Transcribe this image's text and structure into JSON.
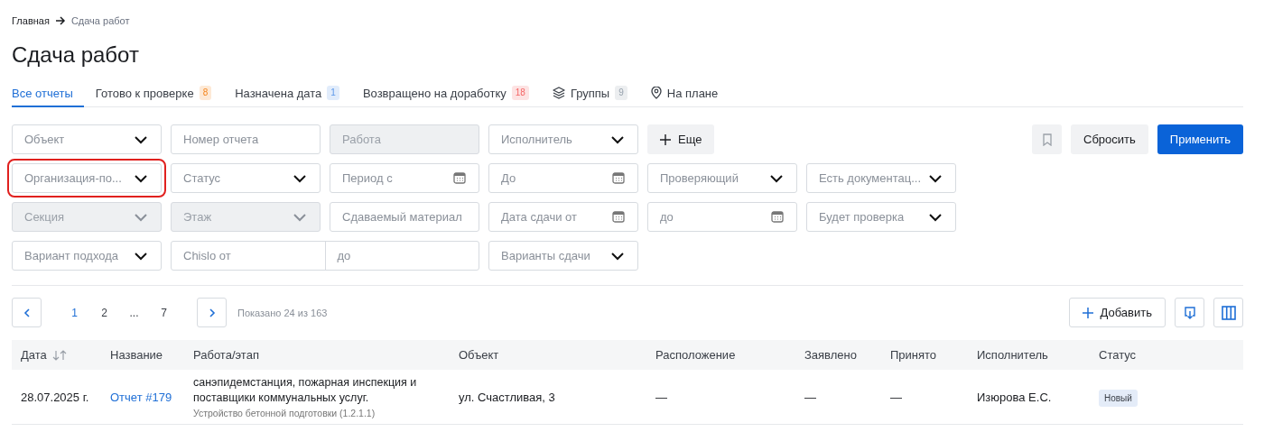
{
  "breadcrumb": [
    "Главная",
    "Сдача работ"
  ],
  "title": "Сдача работ",
  "tabs": [
    {
      "kind": "plain",
      "label": "Все отчеты",
      "selected": true
    },
    {
      "kind": "plain",
      "label": "Готово к проверке",
      "count": "8",
      "color": "#fde9d6",
      "selected": false
    },
    {
      "kind": "plain",
      "label": "Назначена дата",
      "count": "1",
      "color": "#e1ecfb",
      "selected": false
    },
    {
      "kind": "plain",
      "label": "Возвращено на доработку",
      "count": "18",
      "color": "#fde3e3",
      "selected": false
    },
    {
      "kind": "groups",
      "label": "Группы",
      "count": "9",
      "color": "#eceef0",
      "selected": false
    },
    {
      "kind": "map",
      "label": "На плане",
      "selected": false
    }
  ],
  "filters": [
    [
      {
        "kind": "select",
        "placeholder": "Объект",
        "disabled": false
      },
      {
        "kind": "input",
        "placeholder": "Номер отчета",
        "disabled": false
      },
      {
        "kind": "input",
        "placeholder": "Работа",
        "disabled": true
      },
      {
        "kind": "select",
        "placeholder": "Исполнитель",
        "disabled": false
      }
    ],
    [
      {
        "kind": "select",
        "placeholder": "Организация-по...",
        "disabled": false,
        "highlighted": true
      },
      {
        "kind": "select",
        "placeholder": "Статус",
        "disabled": false
      },
      {
        "kind": "date",
        "placeholder": "Период с",
        "disabled": false
      },
      {
        "kind": "date",
        "placeholder": "До",
        "disabled": false
      },
      {
        "kind": "select",
        "placeholder": "Проверяющий",
        "disabled": false
      },
      {
        "kind": "select",
        "placeholder": "Есть документац...",
        "disabled": false
      }
    ],
    [
      {
        "kind": "select",
        "placeholder": "Секция",
        "disabled": true
      },
      {
        "kind": "select",
        "placeholder": "Этаж",
        "disabled": true
      },
      {
        "kind": "input",
        "placeholder": "Сдаваемый материал",
        "disabled": false
      },
      {
        "kind": "date",
        "placeholder": "Дата сдачи от",
        "disabled": false
      },
      {
        "kind": "date",
        "placeholder": "до",
        "disabled": false
      },
      {
        "kind": "select",
        "placeholder": "Будет проверка",
        "disabled": false
      }
    ],
    [
      {
        "kind": "select",
        "placeholder": "Вариант подхода",
        "disabled": false
      },
      {
        "kind": "range",
        "placeholder": "Chislo от",
        "placeholder_to": "до",
        "disabled": false
      },
      {
        "kind": "select",
        "placeholder": "Варианты сдачи",
        "disabled": false
      }
    ]
  ],
  "more_button": "Еще",
  "reset_button": "Сбросить",
  "apply_button": "Применить",
  "pages": [
    {
      "label": "1",
      "selected": true
    },
    {
      "label": "2",
      "selected": false
    },
    {
      "label": "...",
      "selected": false
    },
    {
      "label": "7",
      "selected": false
    }
  ],
  "shown": "Показано 24 из 163",
  "add_button": "Добавить",
  "table": {
    "columns": [
      "Дата",
      "Название",
      "Работа/этап",
      "Объект",
      "Расположение",
      "Заявлено",
      "Принято",
      "Исполнитель",
      "Статус"
    ],
    "rows": [
      {
        "date": "28.07.2025 г.",
        "name": "Отчет #179",
        "work": "санэпидемстанция, пожарная инспекция и поставщики коммунальных услуг.",
        "stage": "Устройство бетонной подготовки (1.2.1.1)",
        "object": "ул. Счастливая, 3",
        "location": "—",
        "declared": "—",
        "accepted": "—",
        "executor": "Изюрова Е.С.",
        "status": "Новый"
      }
    ]
  }
}
